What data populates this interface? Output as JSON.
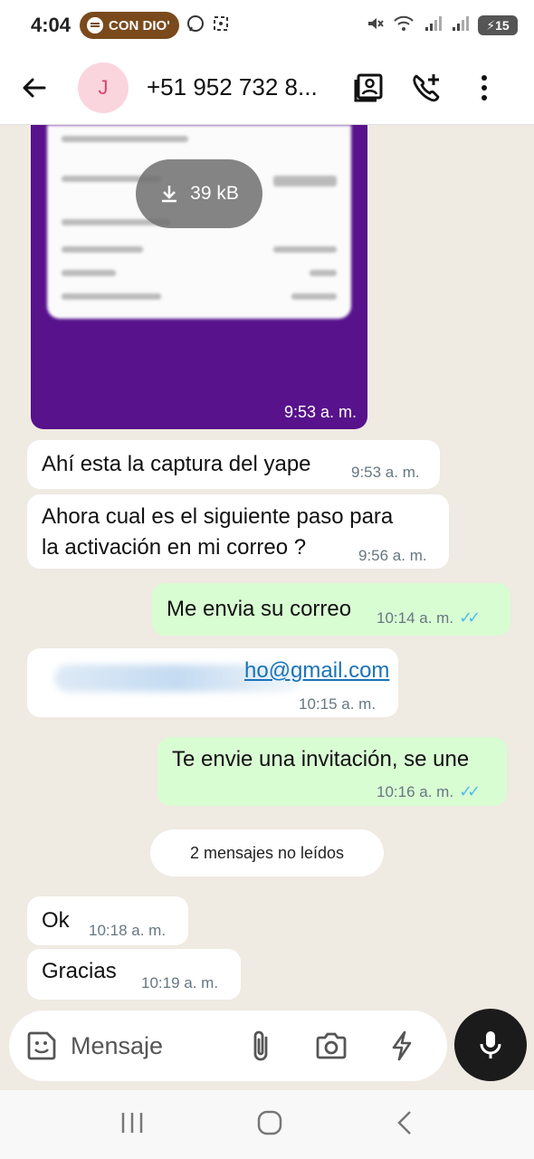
{
  "status_bar": {
    "time": "4:04",
    "spotify_label": "CON DIO'",
    "battery": "15"
  },
  "header": {
    "avatar_initial": "J",
    "contact_name": "+51 952 732 8..."
  },
  "image_message": {
    "download_size": "39 kB",
    "time": "9:53 a. m."
  },
  "messages": [
    {
      "direction": "in",
      "text": "Ahí esta la captura del yape",
      "time": "9:53 a. m."
    },
    {
      "direction": "in",
      "text": "Ahora cual es el siguiente paso para la activación en  mi correo ?",
      "line1": "Ahora cual es el siguiente paso para",
      "line2": "la activación en  mi correo ?",
      "time": "9:56 a. m."
    },
    {
      "direction": "out",
      "text": "Me envia su correo",
      "time": "10:14 a. m.",
      "read": true
    },
    {
      "direction": "in",
      "text": "ho@gmail.com",
      "time": "10:15 a. m.",
      "link": true
    },
    {
      "direction": "out",
      "text": "Te envie una invitación, se une",
      "time": "10:16 a. m.",
      "read": true
    },
    {
      "direction": "in",
      "text": "Ok",
      "time": "10:18 a. m."
    },
    {
      "direction": "in",
      "text": "Gracias",
      "time": "10:19 a. m."
    }
  ],
  "unread_label": "2 mensajes no leídos",
  "input": {
    "placeholder": "Mensaje"
  },
  "colors": {
    "outgoing_bubble": "#d9fdd3",
    "incoming_bubble": "#ffffff",
    "read_ticks": "#53bdeb",
    "chat_background": "#efeae2",
    "image_purple": "#57128c"
  },
  "icons": [
    "back-arrow-icon",
    "contact-card-icon",
    "add-call-icon",
    "more-vert-icon",
    "download-icon",
    "sticker-icon",
    "attach-icon",
    "camera-icon",
    "bolt-icon",
    "mic-icon",
    "recents-icon",
    "home-icon",
    "back-nav-icon"
  ]
}
